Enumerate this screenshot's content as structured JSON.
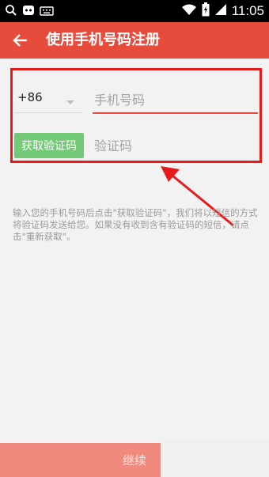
{
  "status_bar": {
    "time": "11:05",
    "icons": [
      "search-icon",
      "app-notification-icon",
      "keyboard-icon",
      "wifi-icon",
      "battery-charging-icon",
      "signal-icon"
    ]
  },
  "app_bar": {
    "back_icon": "arrow-left-icon",
    "title": "使用手机号码注册"
  },
  "form": {
    "country_code": "+86",
    "phone_placeholder": "手机号码",
    "get_code_label": "获取验证码",
    "code_placeholder": "验证码"
  },
  "info_text": "输入您的手机号码后点击\"获取验证码\"，我们将以短信的方式将验证码发送给您。如果没有收到含有验证码的短信，请点击\"重新获取\"。",
  "footer": {
    "continue_label": "继续"
  },
  "colors": {
    "accent": "#e64b3c",
    "highlight": "#e51b1b",
    "button_green": "#74c978"
  }
}
